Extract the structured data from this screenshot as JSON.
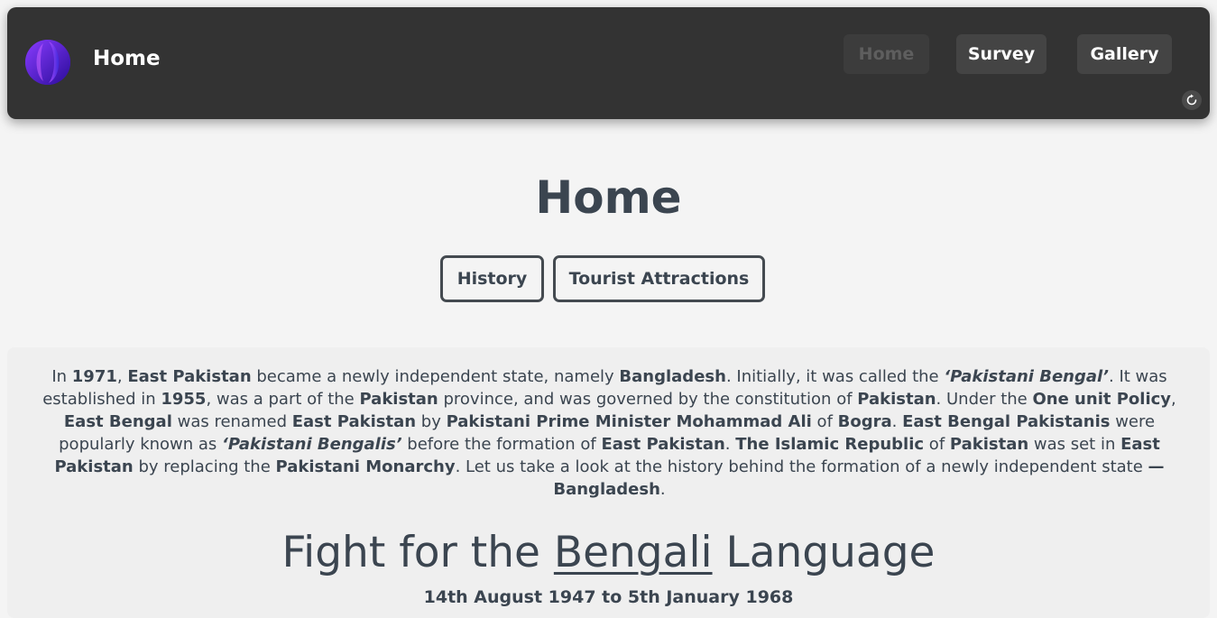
{
  "navbar": {
    "brand_title": "Home",
    "items": [
      {
        "label": "Home",
        "active": true
      },
      {
        "label": "Survey",
        "active": false
      },
      {
        "label": "Gallery",
        "active": false
      }
    ],
    "refresh_icon": "refresh-icon",
    "logo_icon": "logo-icon"
  },
  "main": {
    "title": "Home",
    "tabs": [
      {
        "label": "History"
      },
      {
        "label": "Tourist Attractions"
      }
    ],
    "intro": {
      "p1": "In ",
      "year1971": "1971",
      "p2": ", ",
      "east_pakistan_1": "East Pakistan",
      "p3": " became a newly independent state, namely ",
      "bangladesh_1": "Bangladesh",
      "p4": ". Initially, it was called the ",
      "pakistani_bengal": "‘Pakistani Bengal’",
      "p5": ". It was established in ",
      "year1955": "1955",
      "p6": ", was a part of the ",
      "pakistan_1": "Pakistan",
      "p7": " province, and was governed by the constitution of ",
      "pakistan_2": "Pakistan",
      "p8": ". Under the ",
      "one_unit": "One unit Policy",
      "p9": ", ",
      "east_bengal_1": "East Bengal",
      "p10": " was renamed ",
      "east_pakistan_2": "East Pakistan",
      "p11": " by ",
      "pm": "Pakistani Prime Minister Mohammad Ali",
      "p12": " of ",
      "bogra": "Bogra",
      "p13": ". ",
      "ebp": "East Bengal Pakistanis",
      "p14": " were popularly known as ",
      "pakistani_bengalis": "‘Pakistani Bengalis’",
      "p15": " before the formation of ",
      "east_pakistan_3": "East Pakistan",
      "p16": ". ",
      "islamic_republic": "The Islamic Republic",
      "p17": " of ",
      "pakistan_3": "Pakistan",
      "p18": " was set in ",
      "east_pakistan_4": "East Pakistan",
      "p19": " by replacing the ",
      "monarchy": "Pakistani Monarchy",
      "p20": ". Let us take a look at the history behind the formation of a newly independent state ",
      "dash_bangladesh": "— Bangladesh",
      "p21": "."
    },
    "section": {
      "heading_pre": "Fight for the ",
      "heading_underlined": "Bengali",
      "heading_post": " Language",
      "dates": "14th August 1947 to 5th January 1968"
    }
  },
  "colors": {
    "navbar_bg": "#333333",
    "page_bg": "#f4f4f4",
    "text": "#3b4550",
    "logo_accent": "#5a1ee6"
  }
}
